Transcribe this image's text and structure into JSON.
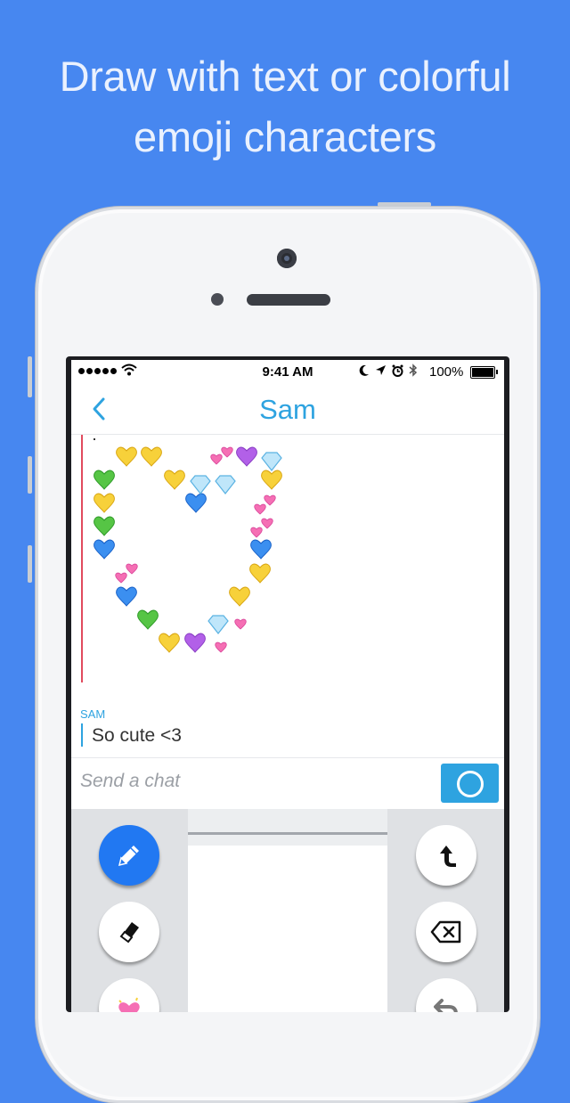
{
  "headline": {
    "line1": "Draw with text or colorful",
    "line2": "emoji characters"
  },
  "status_bar": {
    "time": "9:41 AM",
    "battery": "100%"
  },
  "navbar": {
    "title": "Sam",
    "back_icon": "chevron-left-icon"
  },
  "message": {
    "sender": "SAM",
    "text": "So cute <3"
  },
  "chat": {
    "placeholder": "Send a chat",
    "send_icon": "circle-send-icon"
  },
  "tools_left": [
    "pencil-icon",
    "eraser-icon",
    "emoji-heart-icon"
  ],
  "tools_right": [
    "shift-icon",
    "backspace-icon",
    "undo-icon"
  ],
  "colors": {
    "background": "#4787f0",
    "accent": "#2ea3e0",
    "active_tool": "#2178f2",
    "rule": "#e14b5e"
  }
}
